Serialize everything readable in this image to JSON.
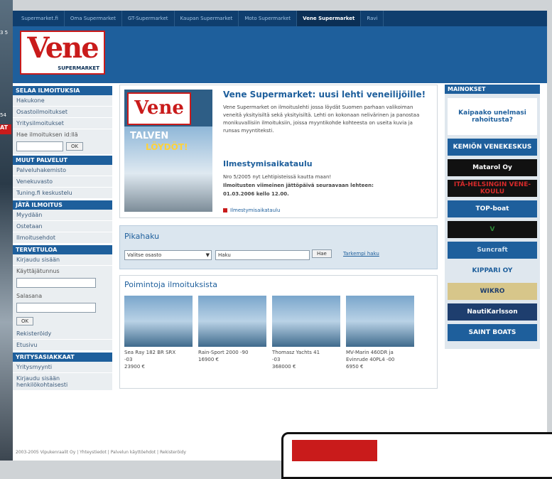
{
  "topnav": {
    "tabs": [
      "Supermarket.fi",
      "Oma Supermarket",
      "GT-Supermarket",
      "Kaupan Supermarket",
      "Moto Supermarket",
      "Vene Supermarket",
      "Ravi"
    ],
    "active_index": 5
  },
  "header": {
    "logo_text": "Vene",
    "logo_sub": "SUPERMARKET"
  },
  "left_edge": {
    "frag1": "3 5",
    "frag2": "54",
    "frag3": "AT"
  },
  "sidebar": {
    "sections": [
      {
        "title": "SELAA ILMOITUKSIA",
        "items": [
          "Hakukone",
          "Osastoilmoitukset",
          "Yritysilmoitukset"
        ]
      },
      {
        "title": "MUUT PALVELUT",
        "items": [
          "Palveluhakemisto",
          "Venekuvasto",
          "Tuning.fi keskustelu"
        ]
      },
      {
        "title": "JÄTÄ ILMOITUS",
        "items": [
          "Myydään",
          "Ostetaan",
          "Ilmoitusehdot"
        ]
      },
      {
        "title": "TERVETULOA",
        "items": [
          "Kirjaudu sisään"
        ]
      },
      {
        "title": "YRITYSASIAKKAAT",
        "items": [
          "Yritysmyynti",
          "Kirjaudu sisään henkilökohtaisesti"
        ]
      }
    ],
    "id_search_label": "Hae ilmoituksen id:llä",
    "ok": "OK",
    "username_label": "Käyttäjätunnus",
    "password_label": "Salasana",
    "after_login": [
      "Rekisteröidy",
      "Etusivu"
    ]
  },
  "promo": {
    "title": "Vene Supermarket: uusi lehti veneilijöille!",
    "body": "Vene Supermarket on ilmoituslehti jossa löydät Suomen parhaan valikoiman veneitä yksityisiltä sekä yksityisiltä. Lehti on kokonaan nelivärinen ja panostaa monikuvallisiin ilmoituksiin, joissa myyntikohde kohteesta on useita kuvia ja runsas myyntiteksti.",
    "schedule_title": "Ilmestymisaikataulu",
    "schedule_l1": "Nro 5/2005 nyt Lehtipisteissä kautta maan!",
    "schedule_l2": "Ilmoitusten viimeinen jättöpäivä seuraavaan lehteen:",
    "schedule_l3": "01.03.2006 kello 12.00.",
    "link": "Ilmestymisaikataulu",
    "magazine_logo": "Vene",
    "mag_t1": "TALVEN",
    "mag_t2": "LÖYDÖT!"
  },
  "search": {
    "title": "Pikahaku",
    "select_value": "Valitse osasto",
    "input_value": "Haku",
    "button": "Hae",
    "advanced": "Tarkempi haku"
  },
  "picks": {
    "title": "Poimintoja ilmoituksista",
    "items": [
      {
        "name": "Sea Ray 182 BR SRX",
        "year": "-03",
        "price": "23900 €"
      },
      {
        "name": "Rain-Sport 2000 -90",
        "year": "",
        "price": "16900 €"
      },
      {
        "name": "Thomasz Yachts 41",
        "year": "-03",
        "price": "368000 €"
      },
      {
        "name": "MV-Marin 460DR ja Evinrude 40PL4 -00",
        "year": "",
        "price": "6950 €"
      }
    ]
  },
  "right": {
    "title": "MAINOKSET",
    "ads": [
      {
        "text": "Kaipaako unelmasi rahoitusta?",
        "bg": "#ffffff",
        "fg": "#1e5f9c"
      },
      {
        "text": "KEMIÖN VENEKESKUS",
        "bg": "#1e5f9c",
        "fg": "#ffffff"
      },
      {
        "text": "Matarol Oy",
        "bg": "#111111",
        "fg": "#ffffff"
      },
      {
        "text": "ITÄ-HELSINGIN VENE-KOULU",
        "bg": "#111111",
        "fg": "#d62a2a"
      },
      {
        "text": "TOP-boat",
        "bg": "#1e5f9c",
        "fg": "#ffffff"
      },
      {
        "text": "V",
        "bg": "#111111",
        "fg": "#2e8a38"
      },
      {
        "text": "Suncraft",
        "bg": "#1e5f9c",
        "fg": "#cfe0ef"
      },
      {
        "text": "KIPPARI OY",
        "bg": "#dfe7ee",
        "fg": "#1e5f9c"
      },
      {
        "text": "WIKRO",
        "bg": "#d7c68a",
        "fg": "#1e3e6e"
      },
      {
        "text": "NautiKarlsson",
        "bg": "#1e3e6e",
        "fg": "#ffffff"
      },
      {
        "text": "SAINT BOATS",
        "bg": "#1e5f9c",
        "fg": "#ffffff"
      }
    ]
  },
  "footer": "2003-2005 Vipukenraalit Oy | Yhteystiedot | Palvelun käyttöehdot | Rekisteröidy"
}
